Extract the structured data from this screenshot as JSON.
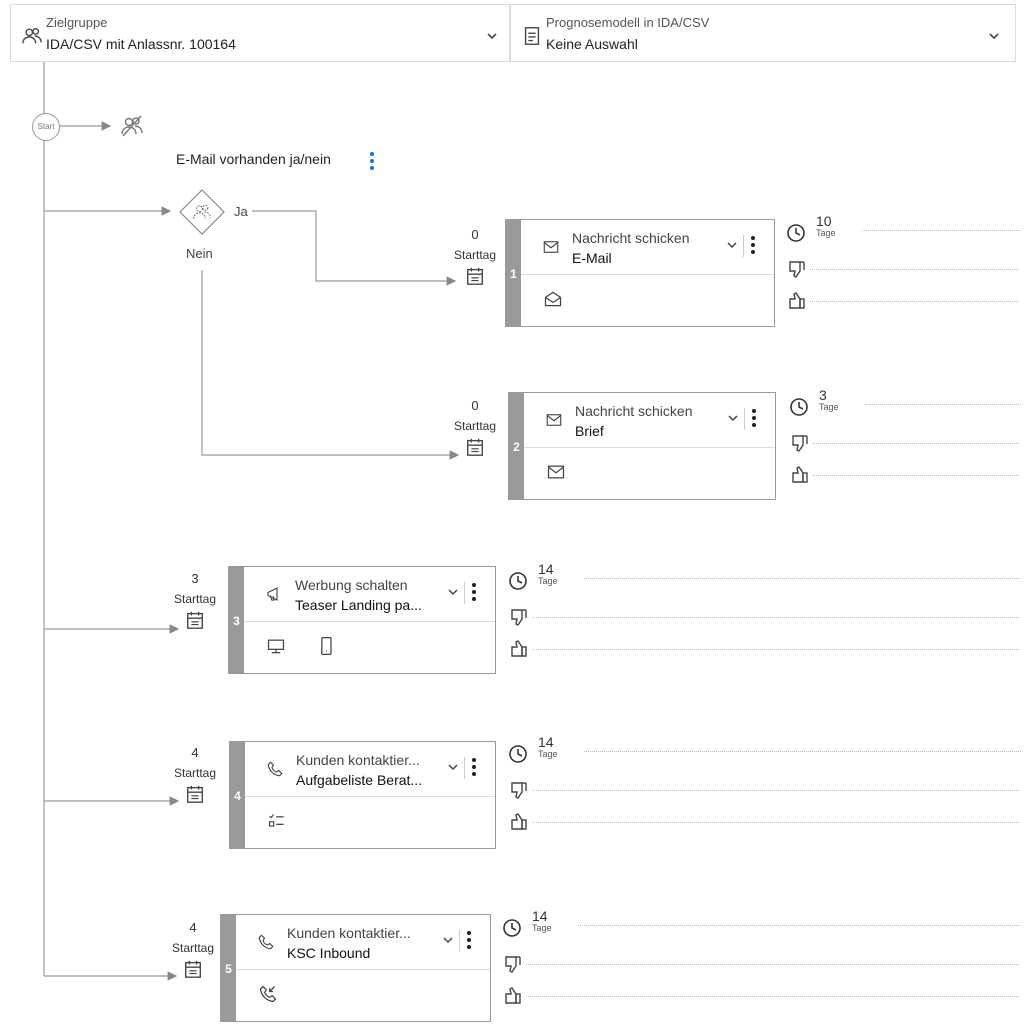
{
  "header": {
    "target_group": {
      "label": "Zielgruppe",
      "value": "IDA/CSV mit Anlassnr. 100164"
    },
    "forecast_model": {
      "label": "Prognosemodell in IDA/CSV",
      "value": "Keine Auswahl"
    }
  },
  "flow": {
    "start_label": "Start",
    "condition": {
      "title": "E-Mail vorhanden ja/nein",
      "yes": "Ja",
      "no": "Nein"
    },
    "steps": [
      {
        "number": "1",
        "start_day": "0",
        "start_label": "Starttag",
        "action": "Nachricht schicken",
        "channel": "E-Mail",
        "duration": "10",
        "unit": "Tage",
        "icon": "envelope-icon",
        "channel_icons": [
          "open-envelope-icon"
        ]
      },
      {
        "number": "2",
        "start_day": "0",
        "start_label": "Starttag",
        "action": "Nachricht schicken",
        "channel": "Brief",
        "duration": "3",
        "unit": "Tage",
        "icon": "envelope-icon",
        "channel_icons": [
          "envelope-icon"
        ]
      },
      {
        "number": "3",
        "start_day": "3",
        "start_label": "Starttag",
        "action": "Werbung schalten",
        "channel": "Teaser Landing pa...",
        "duration": "14",
        "unit": "Tage",
        "icon": "megaphone-icon",
        "channel_icons": [
          "desktop-icon",
          "mobile-icon"
        ]
      },
      {
        "number": "4",
        "start_day": "4",
        "start_label": "Starttag",
        "action": "Kunden kontaktier...",
        "channel": "Aufgabeliste Berat...",
        "duration": "14",
        "unit": "Tage",
        "icon": "phone-icon",
        "channel_icons": [
          "checklist-icon"
        ]
      },
      {
        "number": "5",
        "start_day": "4",
        "start_label": "Starttag",
        "action": "Kunden kontaktier...",
        "channel": "KSC Inbound",
        "duration": "14",
        "unit": "Tage",
        "icon": "phone-icon",
        "channel_icons": [
          "inbound-call-icon"
        ]
      }
    ]
  }
}
